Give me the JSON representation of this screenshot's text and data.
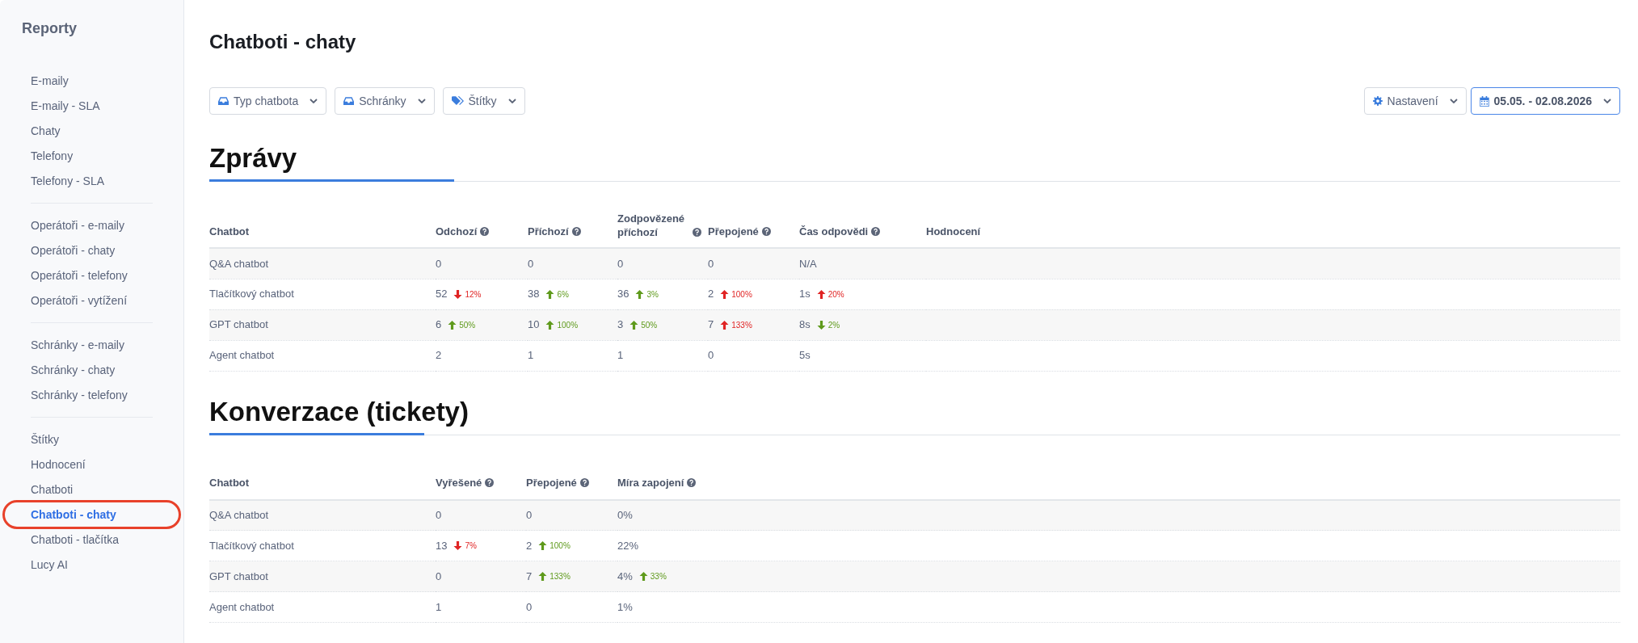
{
  "sidebar": {
    "title": "Reporty",
    "groups": [
      [
        {
          "label": "E-maily",
          "selected": false,
          "annotated": false
        },
        {
          "label": "E-maily - SLA",
          "selected": false,
          "annotated": false
        },
        {
          "label": "Chaty",
          "selected": false,
          "annotated": false
        },
        {
          "label": "Telefony",
          "selected": false,
          "annotated": false
        },
        {
          "label": "Telefony - SLA",
          "selected": false,
          "annotated": false
        }
      ],
      [
        {
          "label": "Operátoři - e-maily",
          "selected": false,
          "annotated": false
        },
        {
          "label": "Operátoři - chaty",
          "selected": false,
          "annotated": false
        },
        {
          "label": "Operátoři - telefony",
          "selected": false,
          "annotated": false
        },
        {
          "label": "Operátoři - vytížení",
          "selected": false,
          "annotated": false
        }
      ],
      [
        {
          "label": "Schránky - e-maily",
          "selected": false,
          "annotated": false
        },
        {
          "label": "Schránky - chaty",
          "selected": false,
          "annotated": false
        },
        {
          "label": "Schránky - telefony",
          "selected": false,
          "annotated": false
        }
      ],
      [
        {
          "label": "Štítky",
          "selected": false,
          "annotated": false
        },
        {
          "label": "Hodnocení",
          "selected": false,
          "annotated": false
        },
        {
          "label": "Chatboti",
          "selected": false,
          "annotated": false
        },
        {
          "label": "Chatboti - chaty",
          "selected": true,
          "annotated": true
        },
        {
          "label": "Chatboti - tlačítka",
          "selected": false,
          "annotated": false
        },
        {
          "label": "Lucy AI",
          "selected": false,
          "annotated": false
        }
      ]
    ]
  },
  "page_title": "Chatboti - chaty",
  "filters": [
    {
      "label": "Typ chatbota",
      "kind": "inbox"
    },
    {
      "label": "Schránky",
      "kind": "inbox"
    },
    {
      "label": "Štítky",
      "kind": "tags"
    }
  ],
  "settings_button": {
    "label": "Nastavení"
  },
  "date_range": {
    "label": "05.05. - 02.08.2026"
  },
  "sections": [
    {
      "title": "Zprávy",
      "columns": [
        {
          "label": "Chatbot",
          "help": false
        },
        {
          "label": "Odchozí",
          "help": true
        },
        {
          "label": "Příchozí",
          "help": true
        },
        {
          "label": "Zodpovězené příchozí",
          "help": true
        },
        {
          "label": "Přepojené",
          "help": true
        },
        {
          "label": "Čas odpovědi",
          "help": true
        },
        {
          "label": "Hodnocení",
          "help": false
        }
      ],
      "rows": [
        [
          {
            "value": "Q&A chatbot"
          },
          {
            "value": "0"
          },
          {
            "value": "0"
          },
          {
            "value": "0"
          },
          {
            "value": "0"
          },
          {
            "value": "N/A"
          },
          {}
        ],
        [
          {
            "value": "Tlačítkový chatbot"
          },
          {
            "value": "52",
            "change": {
              "kind": "down",
              "color": "#e02424",
              "text": "12%"
            }
          },
          {
            "value": "38",
            "change": {
              "kind": "up",
              "color": "#5f9a1c",
              "text": "6%"
            }
          },
          {
            "value": "36",
            "change": {
              "kind": "up",
              "color": "#5f9a1c",
              "text": "3%"
            }
          },
          {
            "value": "2",
            "change": {
              "kind": "up",
              "color": "#e02424",
              "text": "100%"
            }
          },
          {
            "value": "1s",
            "change": {
              "kind": "up",
              "color": "#e02424",
              "text": "20%"
            }
          },
          {}
        ],
        [
          {
            "value": "GPT chatbot"
          },
          {
            "value": "6",
            "change": {
              "kind": "up",
              "color": "#5f9a1c",
              "text": "50%"
            }
          },
          {
            "value": "10",
            "change": {
              "kind": "up",
              "color": "#5f9a1c",
              "text": "100%"
            }
          },
          {
            "value": "3",
            "change": {
              "kind": "up",
              "color": "#5f9a1c",
              "text": "50%"
            }
          },
          {
            "value": "7",
            "change": {
              "kind": "up",
              "color": "#e02424",
              "text": "133%"
            }
          },
          {
            "value": "8s",
            "change": {
              "kind": "down",
              "color": "#5f9a1c",
              "text": "2%"
            }
          },
          {}
        ],
        [
          {
            "value": "Agent chatbot"
          },
          {
            "value": "2"
          },
          {
            "value": "1"
          },
          {
            "value": "1"
          },
          {
            "value": "0"
          },
          {
            "value": "5s"
          },
          {}
        ]
      ]
    },
    {
      "title": "Konverzace (tickety)",
      "columns": [
        {
          "label": "Chatbot",
          "help": false
        },
        {
          "label": "Vyřešené",
          "help": true
        },
        {
          "label": "Přepojené",
          "help": true
        },
        {
          "label": "Míra zapojení",
          "help": true
        }
      ],
      "rows": [
        [
          {
            "value": "Q&A chatbot"
          },
          {
            "value": "0"
          },
          {
            "value": "0"
          },
          {
            "value": "0%"
          }
        ],
        [
          {
            "value": "Tlačítkový chatbot"
          },
          {
            "value": "13",
            "change": {
              "kind": "down",
              "color": "#e02424",
              "text": "7%"
            }
          },
          {
            "value": "2",
            "change": {
              "kind": "up",
              "color": "#5f9a1c",
              "text": "100%"
            }
          },
          {
            "value": "22%"
          }
        ],
        [
          {
            "value": "GPT chatbot"
          },
          {
            "value": "0"
          },
          {
            "value": "7",
            "change": {
              "kind": "up",
              "color": "#5f9a1c",
              "text": "133%"
            }
          },
          {
            "value": "4%",
            "change": {
              "kind": "up",
              "color": "#5f9a1c",
              "text": "33%"
            }
          }
        ],
        [
          {
            "value": "Agent chatbot"
          },
          {
            "value": "1"
          },
          {
            "value": "0"
          },
          {
            "value": "1%"
          }
        ]
      ]
    }
  ]
}
